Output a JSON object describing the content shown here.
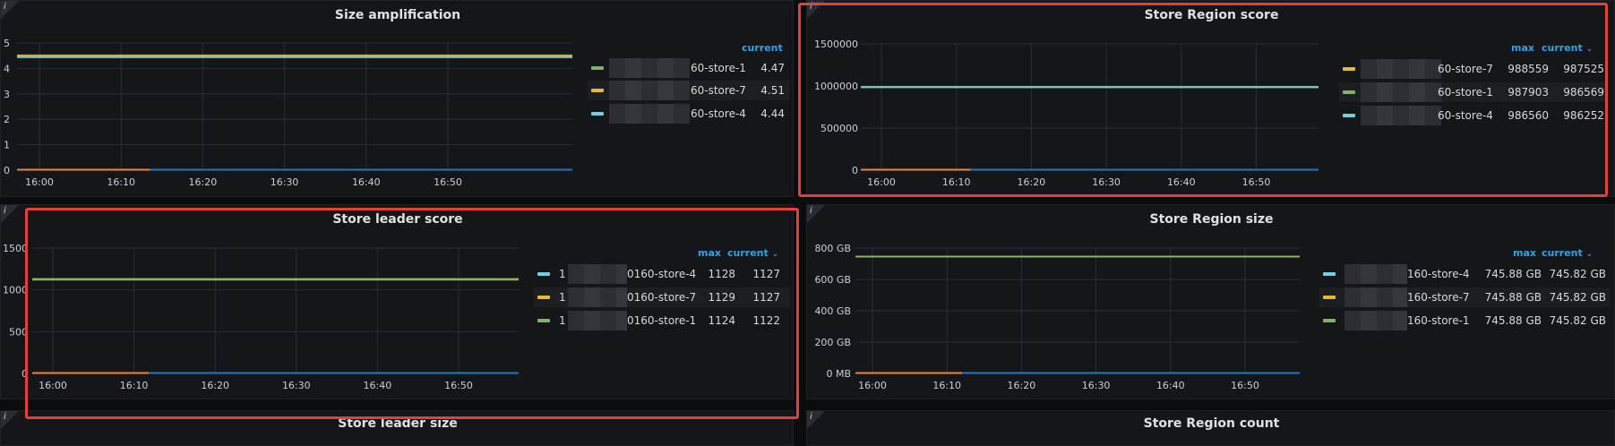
{
  "colors": {
    "green": "#7eb26d",
    "yellow": "#eab839",
    "cyan": "#6ed0e0",
    "orange": "#ef843c",
    "blue": "#1f78c1",
    "highlight": "#e0413a",
    "accent": "#33a2e5"
  },
  "panels": {
    "size_amp": {
      "title": "Size amplification",
      "legend": {
        "current_label": "current",
        "rows": [
          {
            "name": "60-store-1",
            "current": "4.47",
            "color": "green"
          },
          {
            "name": "60-store-7",
            "current": "4.51",
            "color": "yellow"
          },
          {
            "name": "60-store-4",
            "current": "4.44",
            "color": "cyan"
          }
        ]
      }
    },
    "region_score": {
      "title": "Store Region score",
      "legend": {
        "max_label": "max",
        "current_label": "current",
        "rows": [
          {
            "name": "60-store-7",
            "max": "988559",
            "current": "987525",
            "color": "yellow"
          },
          {
            "name": "60-store-1",
            "max": "987903",
            "current": "986569",
            "color": "green"
          },
          {
            "name": "60-store-4",
            "max": "986560",
            "current": "986252",
            "color": "cyan"
          }
        ]
      }
    },
    "leader_score": {
      "title": "Store leader score",
      "legend": {
        "max_label": "max",
        "current_label": "current",
        "rows": [
          {
            "prefix": "1",
            "name": "0160-store-4",
            "max": "1128",
            "current": "1127",
            "color": "cyan"
          },
          {
            "prefix": "1",
            "name": "0160-store-7",
            "max": "1129",
            "current": "1127",
            "color": "yellow"
          },
          {
            "prefix": "1",
            "name": "0160-store-1",
            "max": "1124",
            "current": "1122",
            "color": "green"
          }
        ]
      }
    },
    "region_size": {
      "title": "Store Region size",
      "legend": {
        "max_label": "max",
        "current_label": "current",
        "rows": [
          {
            "name": "160-store-4",
            "max": "745.88 GB",
            "current": "745.82 GB",
            "color": "cyan"
          },
          {
            "name": "160-store-7",
            "max": "745.88 GB",
            "current": "745.82 GB",
            "color": "yellow"
          },
          {
            "name": "160-store-1",
            "max": "745.88 GB",
            "current": "745.82 GB",
            "color": "green"
          }
        ]
      }
    },
    "leader_size": {
      "title": "Store leader size"
    },
    "region_count": {
      "title": "Store Region count"
    }
  },
  "chart_data": [
    {
      "type": "line",
      "title": "Size amplification",
      "x": [
        "16:00",
        "16:10",
        "16:20",
        "16:30",
        "16:40",
        "16:50"
      ],
      "ylim": [
        0,
        5
      ],
      "yticks": [
        "0",
        "1",
        "2",
        "3",
        "4",
        "5"
      ],
      "grid": true,
      "legend_placement": "right",
      "series": [
        {
          "name": "60-store-1",
          "values": [
            4.47,
            4.47,
            4.47,
            4.47,
            4.47,
            4.47,
            4.47
          ],
          "color": "green"
        },
        {
          "name": "60-store-7",
          "values": [
            4.51,
            4.51,
            4.51,
            4.51,
            4.51,
            4.51,
            4.51
          ],
          "color": "yellow"
        },
        {
          "name": "60-store-4",
          "values": [
            4.44,
            4.44,
            4.44,
            4.44,
            4.44,
            4.44,
            4.44
          ],
          "color": "cyan"
        }
      ]
    },
    {
      "type": "line",
      "title": "Store Region score",
      "x": [
        "16:00",
        "16:10",
        "16:20",
        "16:30",
        "16:40",
        "16:50"
      ],
      "ylim": [
        0,
        1500000
      ],
      "yticks": [
        "0",
        "500000",
        "1000000",
        "1500000"
      ],
      "grid": true,
      "legend_placement": "right",
      "series": [
        {
          "name": "60-store-7",
          "values": [
            987525,
            987525,
            987525,
            987525,
            987525,
            987525,
            987525
          ],
          "color": "yellow"
        },
        {
          "name": "60-store-1",
          "values": [
            986569,
            986569,
            986569,
            986569,
            986569,
            986569,
            986569
          ],
          "color": "green"
        },
        {
          "name": "60-store-4",
          "values": [
            986252,
            986252,
            986252,
            986252,
            986252,
            986252,
            986252
          ],
          "color": "cyan"
        }
      ]
    },
    {
      "type": "line",
      "title": "Store leader score",
      "x": [
        "16:00",
        "16:10",
        "16:20",
        "16:30",
        "16:40",
        "16:50"
      ],
      "ylim": [
        0,
        1500
      ],
      "yticks": [
        "0",
        "500",
        "1000",
        "1500"
      ],
      "grid": true,
      "legend_placement": "right",
      "series": [
        {
          "name": "0160-store-4",
          "values": [
            1127,
            1127,
            1127,
            1127,
            1127,
            1127,
            1127
          ],
          "color": "cyan"
        },
        {
          "name": "0160-store-7",
          "values": [
            1127,
            1127,
            1127,
            1127,
            1127,
            1127,
            1127
          ],
          "color": "yellow"
        },
        {
          "name": "0160-store-1",
          "values": [
            1122,
            1122,
            1122,
            1122,
            1122,
            1122,
            1122
          ],
          "color": "green"
        }
      ]
    },
    {
      "type": "line",
      "title": "Store Region size",
      "x": [
        "16:00",
        "16:10",
        "16:20",
        "16:30",
        "16:40",
        "16:50"
      ],
      "ylim": [
        0,
        800
      ],
      "yticks": [
        "0 MB",
        "200 GB",
        "400 GB",
        "600 GB",
        "800 GB"
      ],
      "grid": true,
      "legend_placement": "right",
      "series": [
        {
          "name": "160-store-4",
          "values": [
            745.82,
            745.82,
            745.82,
            745.82,
            745.82,
            745.82,
            745.82
          ],
          "color": "cyan"
        },
        {
          "name": "160-store-7",
          "values": [
            745.82,
            745.82,
            745.82,
            745.82,
            745.82,
            745.82,
            745.82
          ],
          "color": "yellow"
        },
        {
          "name": "160-store-1",
          "values": [
            745.82,
            745.82,
            745.82,
            745.82,
            745.82,
            745.82,
            745.82
          ],
          "color": "green"
        }
      ]
    }
  ]
}
